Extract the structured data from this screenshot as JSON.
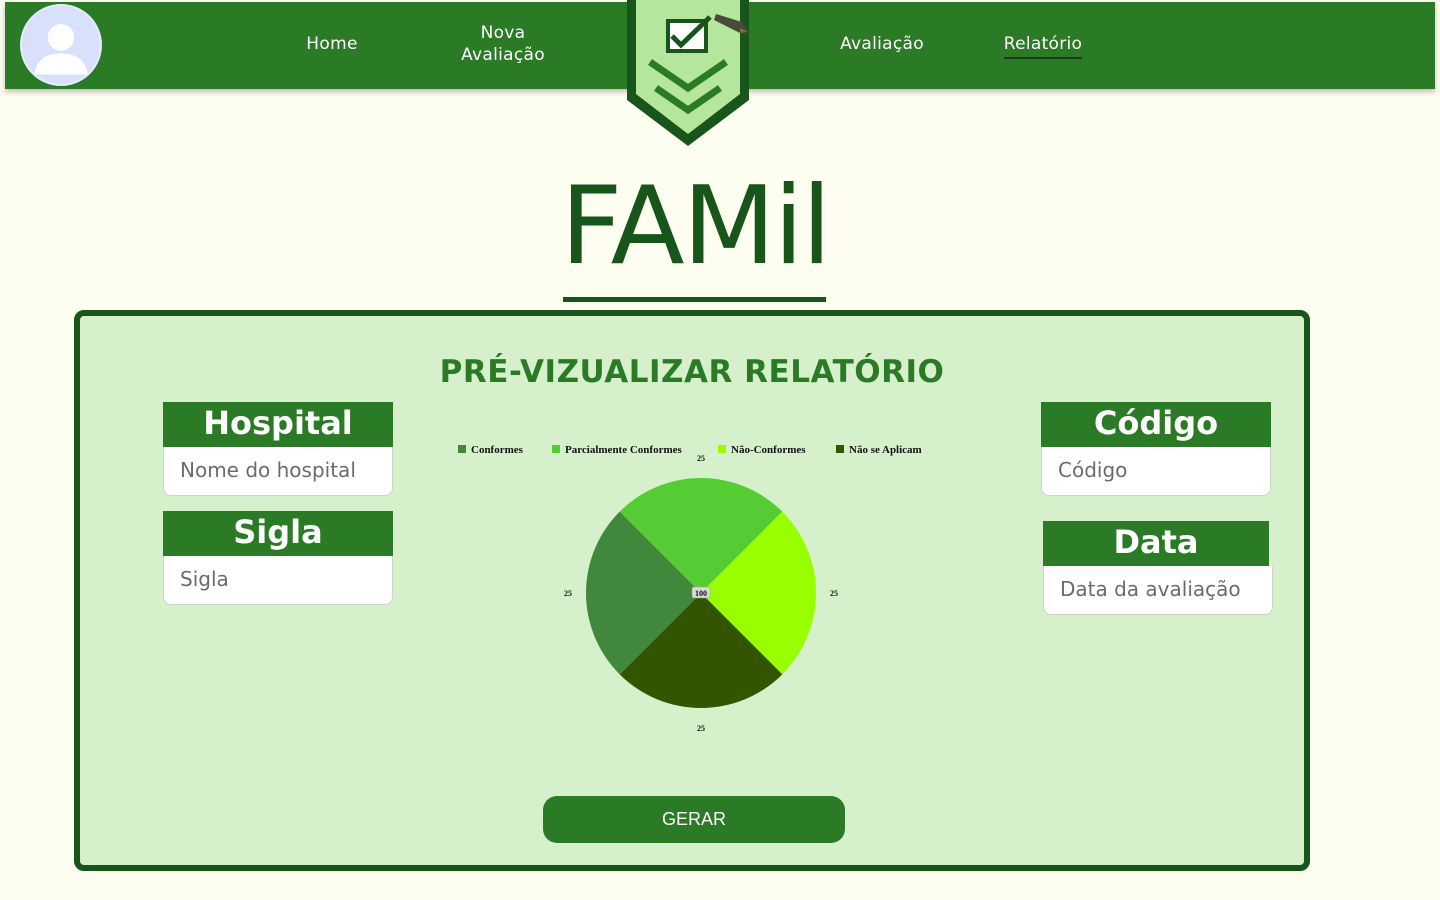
{
  "nav": {
    "home": "Home",
    "nova_line1": "Nova",
    "nova_line2": "Avaliação",
    "avaliacao": "Avaliação",
    "relatorio": "Relatório"
  },
  "brand": "FAMil",
  "panel": {
    "title": "PRÉ-VIZUALIZAR RELATÓRIO",
    "hospital": {
      "label": "Hospital",
      "placeholder": "Nome do hospital"
    },
    "sigla": {
      "label": "Sigla",
      "placeholder": "Sigla"
    },
    "codigo": {
      "label": "Código",
      "placeholder": "Código"
    },
    "data": {
      "label": "Data",
      "placeholder": "Data da avaliação"
    },
    "button": "GERAR"
  },
  "colors": {
    "navbar": "#2b7a26",
    "brand": "#17551a",
    "panel_bg": "#d5f0cb",
    "page_bg": "#fdfdf0"
  },
  "chart_data": {
    "type": "pie",
    "legend_position": "top",
    "series": [
      {
        "name": "Conformes",
        "value": 25,
        "color": "#41873c"
      },
      {
        "name": "Parcialmente Conformes",
        "value": 25,
        "color": "#55cc33"
      },
      {
        "name": "Não-Conformes",
        "value": 25,
        "color": "#99ff00"
      },
      {
        "name": "Não se Aplicam",
        "value": 25,
        "color": "#335500"
      }
    ],
    "total_label": "100"
  }
}
